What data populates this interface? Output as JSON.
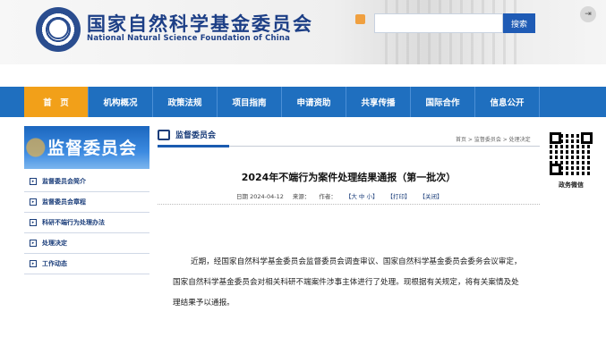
{
  "header": {
    "title": "国家自然科学基金委员会",
    "subtitle": "National Natural Science Foundation of China",
    "search_placeholder": "",
    "search_button": "搜索",
    "exit_glyph": "⇥"
  },
  "nav": {
    "items": [
      {
        "label": "首　页"
      },
      {
        "label": "机构概况"
      },
      {
        "label": "政策法规"
      },
      {
        "label": "项目指南"
      },
      {
        "label": "申请资助"
      },
      {
        "label": "共享传播"
      },
      {
        "label": "国际合作"
      },
      {
        "label": "信息公开"
      }
    ]
  },
  "sidebar": {
    "banner_title": "监督委员会",
    "items": [
      {
        "label": "监督委员会简介"
      },
      {
        "label": "监督委员会章程"
      },
      {
        "label": "科研不端行为处理办法"
      },
      {
        "label": "处理决定"
      },
      {
        "label": "工作动态"
      }
    ]
  },
  "main": {
    "tab_title": "监督委员会",
    "breadcrumb": "首页 > 监督委员会 > 处理决定",
    "article": {
      "title": "2024年不端行为案件处理结果通报（第一批次）",
      "date": "日期 2024-04-12",
      "source": "来源：",
      "author": "作者：",
      "font_size": "【大 中 小】",
      "print": "【打印】",
      "close": "【关闭】",
      "body": "近期，经国家自然科学基金委员会监督委员会调查审议、国家自然科学基金委员会委务会议审定，国家自然科学基金委员会对相关科研不端案件涉事主体进行了处理。现根据有关规定，将有关案情及处理结果予以通报。"
    }
  },
  "qr": {
    "caption": "政务微信"
  },
  "colors": {
    "nav_bg": "#1f6fbf",
    "nav_active": "#f2a019",
    "brand_blue": "#1d3f86"
  }
}
